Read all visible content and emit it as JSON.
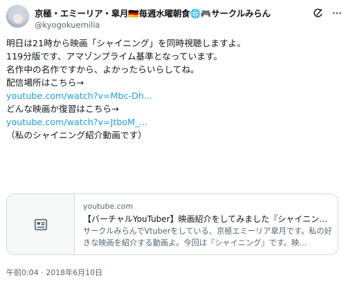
{
  "author": {
    "display_name": "京極・エミーリア・皐月🇩🇪毎週水曜朝食🌐🎮サークルみらん",
    "handle": "@kyogokuemilia"
  },
  "header_icons": [
    "grok-icon",
    "more-icon"
  ],
  "tweet": {
    "line1": "明日は21時から映画「シャイニング」を同時視聴しますよ。",
    "line2": "119分版です、アマゾンプライム基準となっています。",
    "line3": "名作中の名作ですから、よかったらいらしてね。",
    "line4": "配信場所はこちら→",
    "link1": "youtube.com/watch?v=Mbc-Dh...",
    "line5": "どんな映画か復習はこちら→",
    "link2": "youtube.com/watch?v=JtboM_...",
    "line6": "（私のシャイニング紹介動画です）"
  },
  "card": {
    "domain": "youtube.com",
    "title": "【バーチャルYouTuber】映画紹介をしてみました『シャイニング…",
    "description": "サークルみらんでVtuberをしている、京極エミーリア皐月です。私の好きな映画を紹介する動画よ。今回は『シャイニング』です。映…",
    "thumb_icon": "article-icon"
  },
  "timestamp": "午前0:04 · 2018年6月10日"
}
